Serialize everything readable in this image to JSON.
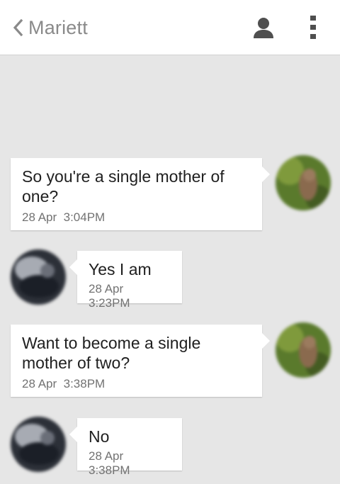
{
  "header": {
    "title": "Mariett",
    "back_icon": "chevron-left-icon",
    "contact_icon": "person-icon",
    "menu_icon": "more-vertical-icon"
  },
  "messages": [
    {
      "direction": "outgoing",
      "text_lines": [
        "So you're a single mother of",
        "one?"
      ],
      "date": "28 Apr",
      "time": "3:04PM"
    },
    {
      "direction": "incoming",
      "text_lines": [
        "Yes I am"
      ],
      "date": "28 Apr",
      "time": "3:23PM"
    },
    {
      "direction": "outgoing",
      "text_lines": [
        "Want to become a single",
        "mother of two?"
      ],
      "date": "28 Apr",
      "time": "3:38PM"
    },
    {
      "direction": "incoming",
      "text_lines": [
        "No"
      ],
      "date": "28 Apr",
      "time": "3:38PM"
    }
  ],
  "colors": {
    "background": "#e6e6e6",
    "header_bg": "#ffffff",
    "bubble_bg": "#ffffff",
    "title_text": "#8a8a8a",
    "message_text": "#202020",
    "time_text": "#727272",
    "icon": "#4f4f4f"
  }
}
